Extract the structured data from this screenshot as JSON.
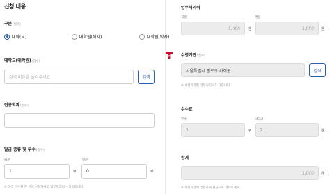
{
  "left": {
    "title": "신청 내용",
    "category": {
      "label": "구분",
      "required": "(필수)",
      "options": [
        "대학(교)",
        "대학원(석사)",
        "대학원(박사)"
      ],
      "selected_index": 0
    },
    "university": {
      "label": "대학교(대학원)",
      "required": "(필수)",
      "placeholder": "검색 버튼을 눌러주세요",
      "search_button": "검색"
    },
    "major": {
      "label": "전공학과",
      "required": "(필수)",
      "value": ""
    },
    "issue": {
      "label": "발급 종류 및 부수",
      "required": "(필수)",
      "korean_label": "국문",
      "korean_value": "1",
      "korean_unit": "부",
      "english_label": "영문",
      "english_value": "0",
      "english_unit": "부",
      "note": "※ 여러 부수를 한 번에 신청하셔도 업무처리비는 동일합니다."
    }
  },
  "right": {
    "processing_fee": {
      "label": "업무처리비",
      "korean_label": "국문",
      "korean_value": "1,000",
      "korean_unit": "원",
      "english_label": "영문",
      "english_value": "1,000",
      "english_unit": "원"
    },
    "agency": {
      "label": "수령기관",
      "required": "(필수)",
      "value": "서울특별시 종로구 사직동",
      "search_button": "검색",
      "note": "※ 수령기관별 업무처리비가 다릅니다."
    },
    "commission": {
      "label": "수수료",
      "copies_label": "부수",
      "copies_value": "1",
      "copies_unit": "부",
      "fee_label": "처리비",
      "fee_value": "0",
      "fee_unit": "원"
    },
    "total": {
      "label": "합계",
      "value": "1,000",
      "unit": "원",
      "note": "※ 수령기관에 방문하여 현금으로 결제하세요."
    }
  },
  "colors": {
    "accent": "#2a5db0",
    "logo": "#c8102e"
  }
}
